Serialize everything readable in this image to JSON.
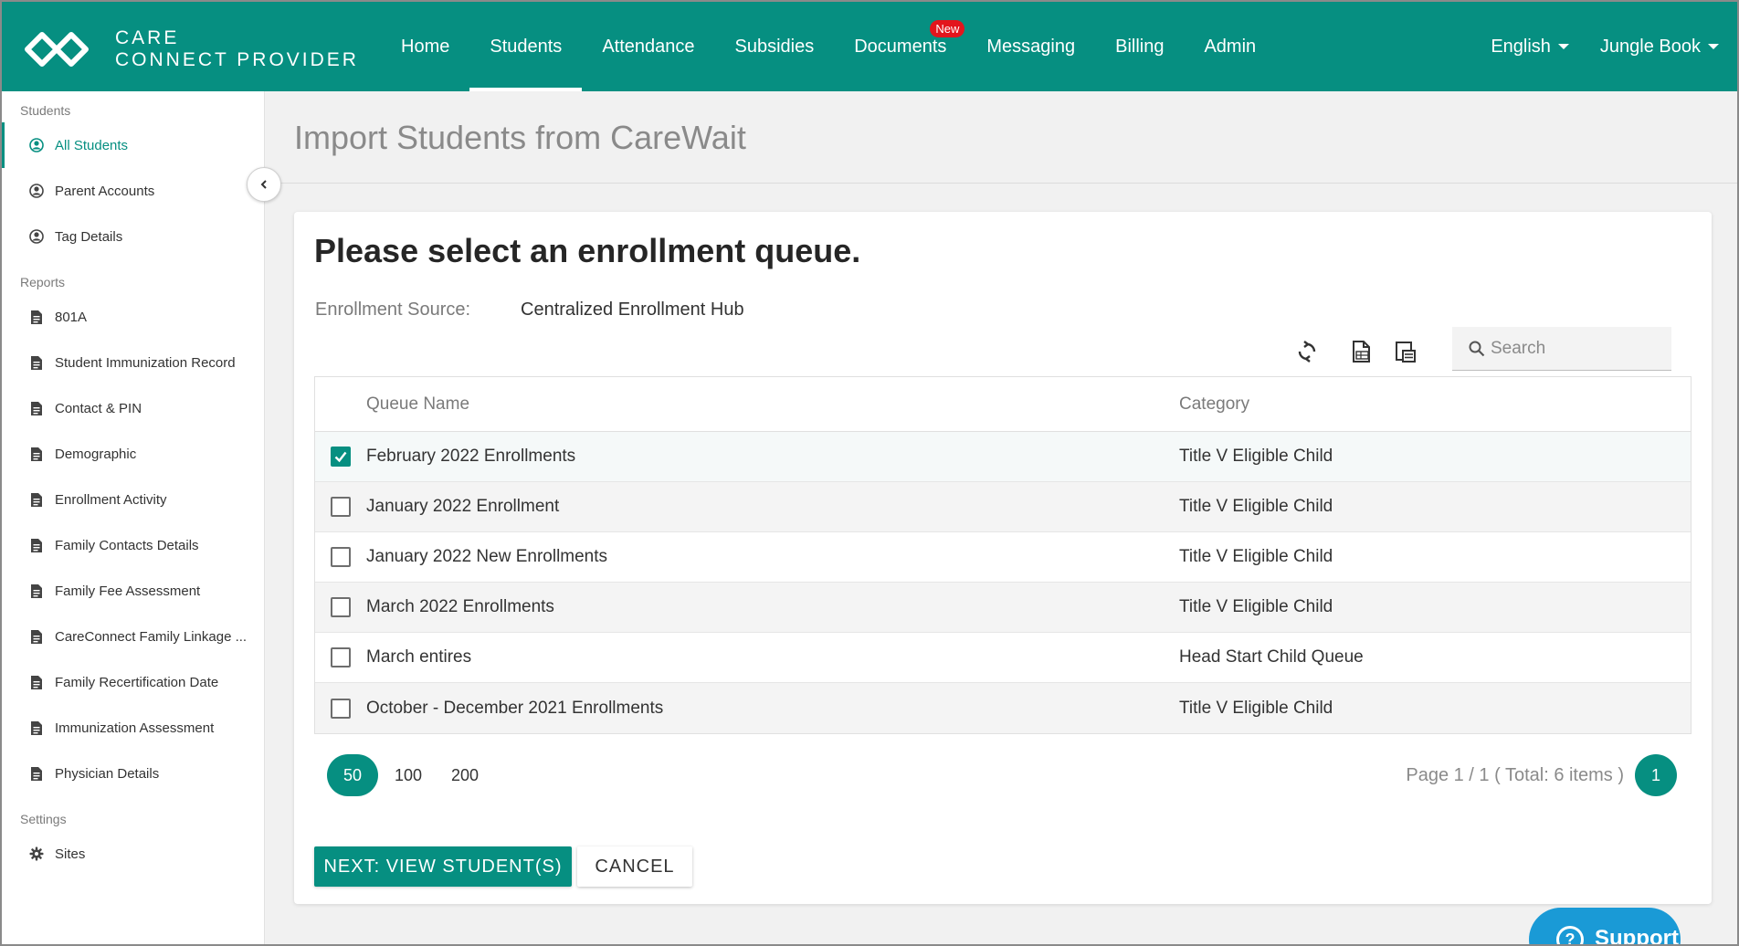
{
  "header": {
    "logo_line1": "CARE",
    "logo_line2": "CONNECT PROVIDER",
    "nav": [
      {
        "label": "Home"
      },
      {
        "label": "Students"
      },
      {
        "label": "Attendance"
      },
      {
        "label": "Subsidies"
      },
      {
        "label": "Documents",
        "badge": "New"
      },
      {
        "label": "Messaging"
      },
      {
        "label": "Billing"
      },
      {
        "label": "Admin"
      }
    ],
    "active_nav": "Students",
    "language": "English",
    "user": "Jungle Book",
    "brand_color": "#068f81",
    "badge_color": "#e3151d"
  },
  "sidebar": {
    "sections": [
      {
        "title": "Students",
        "items": [
          {
            "label": "All Students",
            "icon": "user-circle-icon"
          },
          {
            "label": "Parent Accounts",
            "icon": "user-circle-icon"
          },
          {
            "label": "Tag Details",
            "icon": "user-circle-icon"
          }
        ]
      },
      {
        "title": "Reports",
        "items": [
          {
            "label": "801A",
            "icon": "document-icon"
          },
          {
            "label": "Student Immunization Record",
            "icon": "document-icon"
          },
          {
            "label": "Contact & PIN",
            "icon": "document-icon"
          },
          {
            "label": "Demographic",
            "icon": "document-icon"
          },
          {
            "label": "Enrollment Activity",
            "icon": "document-icon"
          },
          {
            "label": "Family Contacts Details",
            "icon": "document-icon"
          },
          {
            "label": "Family Fee Assessment",
            "icon": "document-icon"
          },
          {
            "label": "CareConnect Family Linkage ...",
            "icon": "document-icon"
          },
          {
            "label": "Family Recertification Date",
            "icon": "document-icon"
          },
          {
            "label": "Immunization Assessment",
            "icon": "document-icon"
          },
          {
            "label": "Physician Details",
            "icon": "document-icon"
          }
        ]
      },
      {
        "title": "Settings",
        "items": [
          {
            "label": "Sites",
            "icon": "gear-icon"
          }
        ]
      }
    ],
    "active_item": "All Students"
  },
  "page": {
    "title": "Import Students from CareWait",
    "heading": "Please select an enrollment queue.",
    "source_label": "Enrollment Source:",
    "source_value": "Centralized Enrollment Hub",
    "search_placeholder": "Search"
  },
  "table": {
    "columns": [
      "Queue Name",
      "Category"
    ],
    "rows": [
      {
        "name": "February 2022 Enrollments",
        "category": "Title V Eligible Child",
        "checked": true
      },
      {
        "name": "January 2022 Enrollment",
        "category": "Title V Eligible Child",
        "checked": false
      },
      {
        "name": "January 2022 New Enrollments",
        "category": "Title V Eligible Child",
        "checked": false
      },
      {
        "name": "March 2022 Enrollments",
        "category": "Title V Eligible Child",
        "checked": false
      },
      {
        "name": "March entires",
        "category": "Head Start Child Queue",
        "checked": false
      },
      {
        "name": "October - December 2021 Enrollments",
        "category": "Title V Eligible Child",
        "checked": false
      }
    ]
  },
  "pager": {
    "sizes": [
      "50",
      "100",
      "200"
    ],
    "active_size": "50",
    "info": "Page 1 / 1 ( Total: 6 items )",
    "current_page": "1"
  },
  "actions": {
    "next_label": "NEXT: VIEW STUDENT(S)",
    "cancel_label": "CANCEL"
  },
  "support": {
    "label": "Support"
  }
}
